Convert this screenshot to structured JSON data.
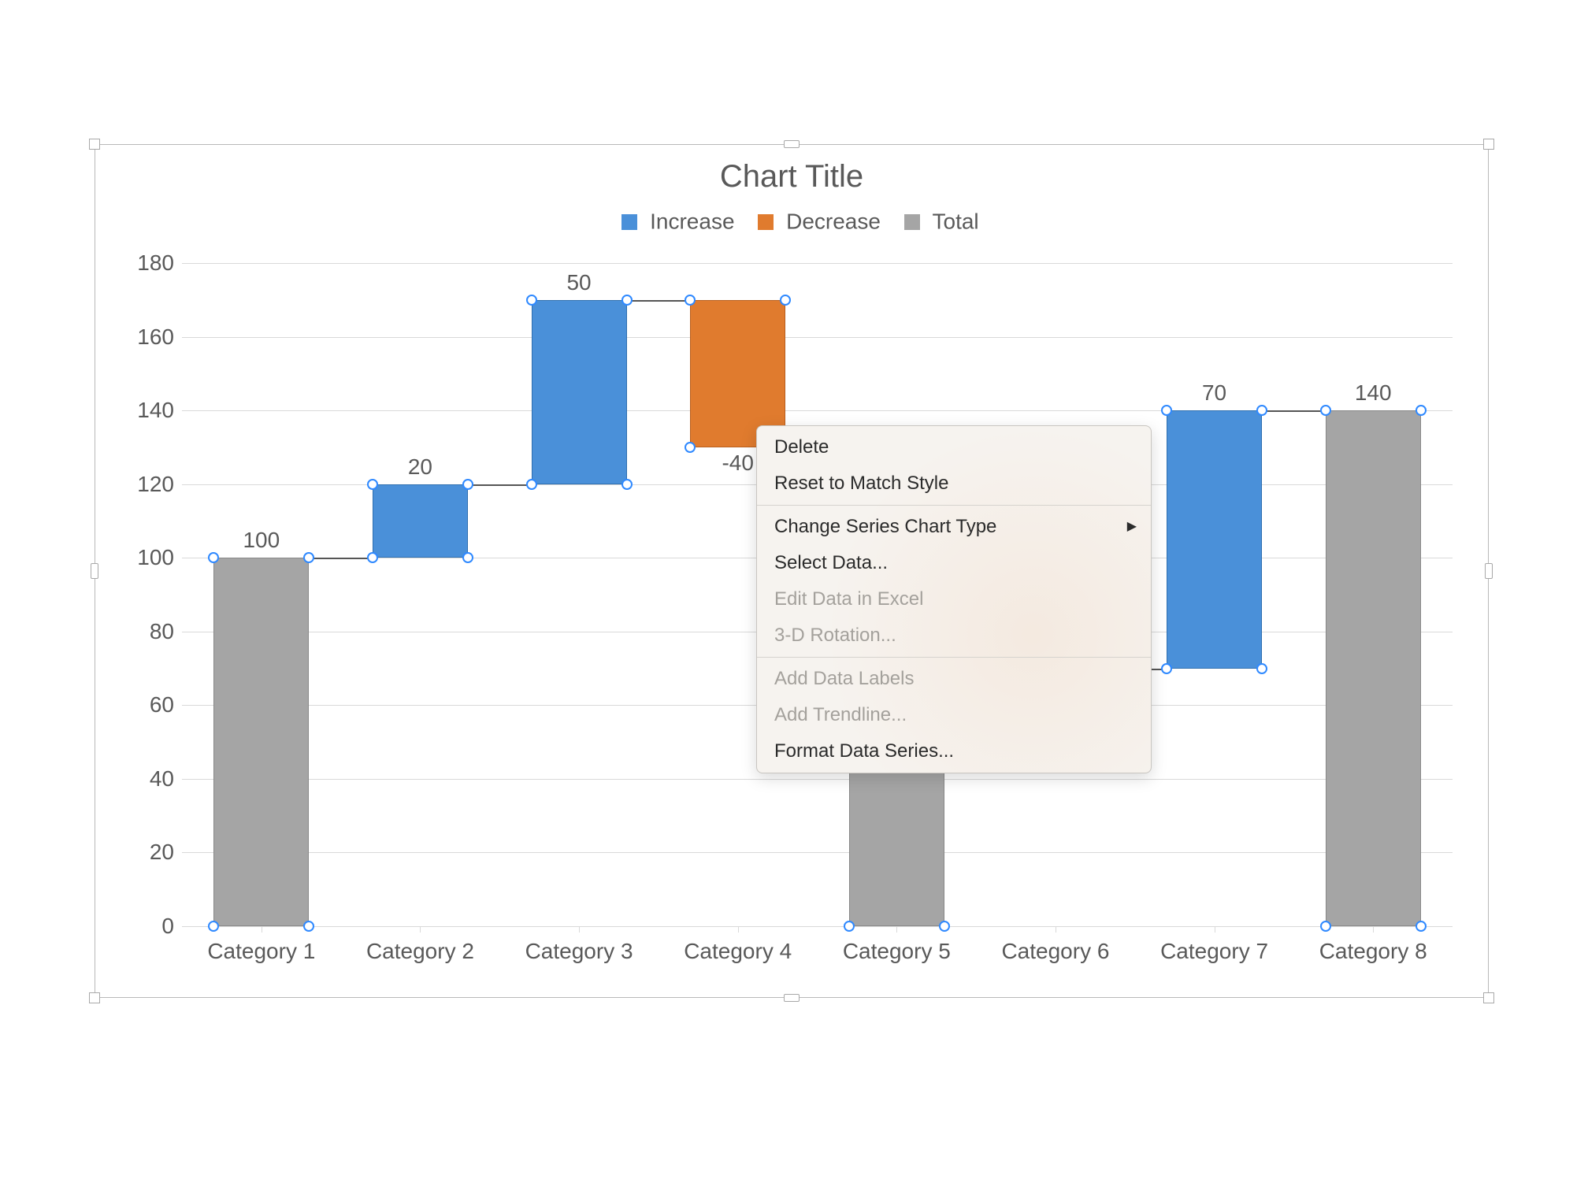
{
  "chart_data": {
    "type": "waterfall",
    "title": "Chart Title",
    "legend": [
      {
        "name": "Increase",
        "color": "#4a90d9"
      },
      {
        "name": "Decrease",
        "color": "#e07b2e"
      },
      {
        "name": "Total",
        "color": "#a5a5a5"
      }
    ],
    "ylabel": "",
    "xlabel": "",
    "ylim": [
      0,
      180
    ],
    "yticks": [
      0,
      20,
      40,
      60,
      80,
      100,
      120,
      140,
      160,
      180
    ],
    "categories": [
      "Category 1",
      "Category 2",
      "Category 3",
      "Category 4",
      "Category 5",
      "Category 6",
      "Category 7",
      "Category 8"
    ],
    "bars": [
      {
        "category": "Category 1",
        "kind": "total",
        "value": 100,
        "label": "100",
        "base": 0,
        "top": 100
      },
      {
        "category": "Category 2",
        "kind": "increase",
        "value": 20,
        "label": "20",
        "base": 100,
        "top": 120
      },
      {
        "category": "Category 3",
        "kind": "increase",
        "value": 50,
        "label": "50",
        "base": 120,
        "top": 170
      },
      {
        "category": "Category 4",
        "kind": "decrease",
        "value": -40,
        "label": "-40",
        "base": 170,
        "top": 130
      },
      {
        "category": "Category 5",
        "kind": "total",
        "value": null,
        "label": "",
        "base": 0,
        "top": null
      },
      {
        "category": "Category 6",
        "kind": "total",
        "value": null,
        "label": "",
        "base": 0,
        "top": null
      },
      {
        "category": "Category 7",
        "kind": "increase",
        "value": 70,
        "label": "70",
        "base": 70,
        "top": 140
      },
      {
        "category": "Category 8",
        "kind": "total",
        "value": 140,
        "label": "140",
        "base": 0,
        "top": 140
      }
    ]
  },
  "context_menu": {
    "items": [
      {
        "label": "Delete",
        "enabled": true,
        "submenu": false
      },
      {
        "label": "Reset to Match Style",
        "enabled": true,
        "submenu": false
      },
      {
        "separator": true
      },
      {
        "label": "Change Series Chart Type",
        "enabled": true,
        "submenu": true
      },
      {
        "label": "Select Data...",
        "enabled": true,
        "submenu": false
      },
      {
        "label": "Edit Data in Excel",
        "enabled": false,
        "submenu": false
      },
      {
        "label": "3-D Rotation...",
        "enabled": false,
        "submenu": false
      },
      {
        "separator": true
      },
      {
        "label": "Add Data Labels",
        "enabled": false,
        "submenu": false
      },
      {
        "label": "Add Trendline...",
        "enabled": false,
        "submenu": false
      },
      {
        "label": "Format Data Series...",
        "enabled": true,
        "submenu": false
      }
    ]
  }
}
